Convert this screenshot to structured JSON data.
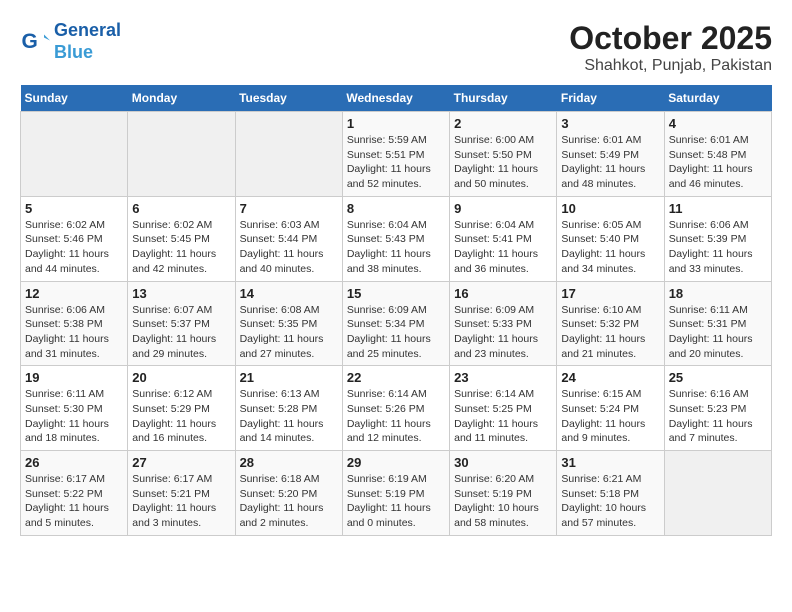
{
  "header": {
    "logo_line1": "General",
    "logo_line2": "Blue",
    "title": "October 2025",
    "subtitle": "Shahkot, Punjab, Pakistan"
  },
  "weekdays": [
    "Sunday",
    "Monday",
    "Tuesday",
    "Wednesday",
    "Thursday",
    "Friday",
    "Saturday"
  ],
  "weeks": [
    [
      {
        "day": "",
        "info": ""
      },
      {
        "day": "",
        "info": ""
      },
      {
        "day": "",
        "info": ""
      },
      {
        "day": "1",
        "info": "Sunrise: 5:59 AM\nSunset: 5:51 PM\nDaylight: 11 hours and 52 minutes."
      },
      {
        "day": "2",
        "info": "Sunrise: 6:00 AM\nSunset: 5:50 PM\nDaylight: 11 hours and 50 minutes."
      },
      {
        "day": "3",
        "info": "Sunrise: 6:01 AM\nSunset: 5:49 PM\nDaylight: 11 hours and 48 minutes."
      },
      {
        "day": "4",
        "info": "Sunrise: 6:01 AM\nSunset: 5:48 PM\nDaylight: 11 hours and 46 minutes."
      }
    ],
    [
      {
        "day": "5",
        "info": "Sunrise: 6:02 AM\nSunset: 5:46 PM\nDaylight: 11 hours and 44 minutes."
      },
      {
        "day": "6",
        "info": "Sunrise: 6:02 AM\nSunset: 5:45 PM\nDaylight: 11 hours and 42 minutes."
      },
      {
        "day": "7",
        "info": "Sunrise: 6:03 AM\nSunset: 5:44 PM\nDaylight: 11 hours and 40 minutes."
      },
      {
        "day": "8",
        "info": "Sunrise: 6:04 AM\nSunset: 5:43 PM\nDaylight: 11 hours and 38 minutes."
      },
      {
        "day": "9",
        "info": "Sunrise: 6:04 AM\nSunset: 5:41 PM\nDaylight: 11 hours and 36 minutes."
      },
      {
        "day": "10",
        "info": "Sunrise: 6:05 AM\nSunset: 5:40 PM\nDaylight: 11 hours and 34 minutes."
      },
      {
        "day": "11",
        "info": "Sunrise: 6:06 AM\nSunset: 5:39 PM\nDaylight: 11 hours and 33 minutes."
      }
    ],
    [
      {
        "day": "12",
        "info": "Sunrise: 6:06 AM\nSunset: 5:38 PM\nDaylight: 11 hours and 31 minutes."
      },
      {
        "day": "13",
        "info": "Sunrise: 6:07 AM\nSunset: 5:37 PM\nDaylight: 11 hours and 29 minutes."
      },
      {
        "day": "14",
        "info": "Sunrise: 6:08 AM\nSunset: 5:35 PM\nDaylight: 11 hours and 27 minutes."
      },
      {
        "day": "15",
        "info": "Sunrise: 6:09 AM\nSunset: 5:34 PM\nDaylight: 11 hours and 25 minutes."
      },
      {
        "day": "16",
        "info": "Sunrise: 6:09 AM\nSunset: 5:33 PM\nDaylight: 11 hours and 23 minutes."
      },
      {
        "day": "17",
        "info": "Sunrise: 6:10 AM\nSunset: 5:32 PM\nDaylight: 11 hours and 21 minutes."
      },
      {
        "day": "18",
        "info": "Sunrise: 6:11 AM\nSunset: 5:31 PM\nDaylight: 11 hours and 20 minutes."
      }
    ],
    [
      {
        "day": "19",
        "info": "Sunrise: 6:11 AM\nSunset: 5:30 PM\nDaylight: 11 hours and 18 minutes."
      },
      {
        "day": "20",
        "info": "Sunrise: 6:12 AM\nSunset: 5:29 PM\nDaylight: 11 hours and 16 minutes."
      },
      {
        "day": "21",
        "info": "Sunrise: 6:13 AM\nSunset: 5:28 PM\nDaylight: 11 hours and 14 minutes."
      },
      {
        "day": "22",
        "info": "Sunrise: 6:14 AM\nSunset: 5:26 PM\nDaylight: 11 hours and 12 minutes."
      },
      {
        "day": "23",
        "info": "Sunrise: 6:14 AM\nSunset: 5:25 PM\nDaylight: 11 hours and 11 minutes."
      },
      {
        "day": "24",
        "info": "Sunrise: 6:15 AM\nSunset: 5:24 PM\nDaylight: 11 hours and 9 minutes."
      },
      {
        "day": "25",
        "info": "Sunrise: 6:16 AM\nSunset: 5:23 PM\nDaylight: 11 hours and 7 minutes."
      }
    ],
    [
      {
        "day": "26",
        "info": "Sunrise: 6:17 AM\nSunset: 5:22 PM\nDaylight: 11 hours and 5 minutes."
      },
      {
        "day": "27",
        "info": "Sunrise: 6:17 AM\nSunset: 5:21 PM\nDaylight: 11 hours and 3 minutes."
      },
      {
        "day": "28",
        "info": "Sunrise: 6:18 AM\nSunset: 5:20 PM\nDaylight: 11 hours and 2 minutes."
      },
      {
        "day": "29",
        "info": "Sunrise: 6:19 AM\nSunset: 5:19 PM\nDaylight: 11 hours and 0 minutes."
      },
      {
        "day": "30",
        "info": "Sunrise: 6:20 AM\nSunset: 5:19 PM\nDaylight: 10 hours and 58 minutes."
      },
      {
        "day": "31",
        "info": "Sunrise: 6:21 AM\nSunset: 5:18 PM\nDaylight: 10 hours and 57 minutes."
      },
      {
        "day": "",
        "info": ""
      }
    ]
  ]
}
